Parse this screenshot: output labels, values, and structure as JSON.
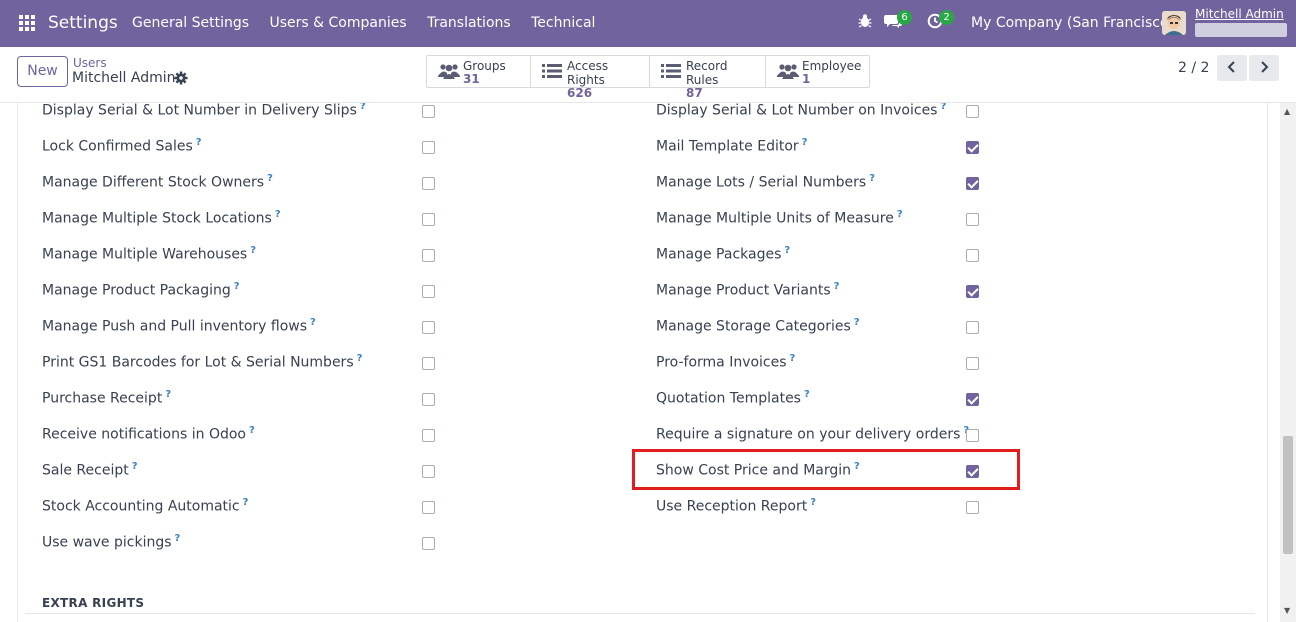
{
  "navbar": {
    "brand": "Settings",
    "menu": [
      "General Settings",
      "Users & Companies",
      "Translations",
      "Technical"
    ],
    "messages_badge": "6",
    "activities_badge": "2",
    "company": "My Company (San Francisco)",
    "user_name": "Mitchell Admin"
  },
  "control": {
    "new_label": "New",
    "breadcrumb_parent": "Users",
    "breadcrumb_current": "Mitchell Admin",
    "stats": [
      {
        "label": "Groups",
        "value": "31",
        "icon": "users-icon"
      },
      {
        "label": "Access Rights",
        "value": "626",
        "icon": "list-icon"
      },
      {
        "label": "Record Rules",
        "value": "87",
        "icon": "list-icon"
      },
      {
        "label": "Employee",
        "value": "1",
        "icon": "users-icon"
      }
    ],
    "pager": "2 / 2"
  },
  "left_column": [
    {
      "label": "Display Serial & Lot Number in Delivery Slips",
      "checked": false
    },
    {
      "label": "Lock Confirmed Sales",
      "checked": false
    },
    {
      "label": "Manage Different Stock Owners",
      "checked": false
    },
    {
      "label": "Manage Multiple Stock Locations",
      "checked": false
    },
    {
      "label": "Manage Multiple Warehouses",
      "checked": false
    },
    {
      "label": "Manage Product Packaging",
      "checked": false
    },
    {
      "label": "Manage Push and Pull inventory flows",
      "checked": false
    },
    {
      "label": "Print GS1 Barcodes for Lot & Serial Numbers",
      "checked": false
    },
    {
      "label": "Purchase Receipt",
      "checked": false
    },
    {
      "label": "Receive notifications in Odoo",
      "checked": false
    },
    {
      "label": "Sale Receipt",
      "checked": false
    },
    {
      "label": "Stock Accounting Automatic",
      "checked": false
    },
    {
      "label": "Use wave pickings",
      "checked": false
    }
  ],
  "right_column": [
    {
      "label": "Display Serial & Lot Number on Invoices",
      "checked": false
    },
    {
      "label": "Mail Template Editor",
      "checked": true
    },
    {
      "label": "Manage Lots / Serial Numbers",
      "checked": true
    },
    {
      "label": "Manage Multiple Units of Measure",
      "checked": false
    },
    {
      "label": "Manage Packages",
      "checked": false
    },
    {
      "label": "Manage Product Variants",
      "checked": true
    },
    {
      "label": "Manage Storage Categories",
      "checked": false
    },
    {
      "label": "Pro-forma Invoices",
      "checked": false
    },
    {
      "label": "Quotation Templates",
      "checked": true
    },
    {
      "label": "Require a signature on your delivery orders",
      "checked": false
    },
    {
      "label": "Show Cost Price and Margin",
      "checked": true
    },
    {
      "label": "Use Reception Report",
      "checked": false
    }
  ],
  "help_mark": "?",
  "section_title": "EXTRA RIGHTS",
  "colors": {
    "brand": "#71639e",
    "highlight": "#e11d1d",
    "badge": "#28a745"
  }
}
